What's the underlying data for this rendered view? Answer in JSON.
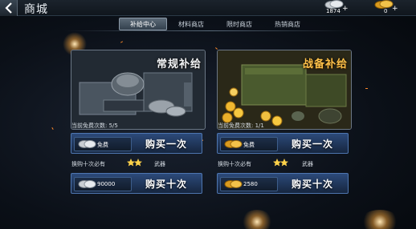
{
  "header": {
    "title": "商城",
    "back_icon": "chevron-left-icon"
  },
  "currencies": [
    {
      "icon": "silver-coin-icon",
      "amount": "1874",
      "plus": "+"
    },
    {
      "icon": "gold-coin-icon",
      "amount": "0",
      "plus": "+"
    }
  ],
  "tabs": [
    {
      "label": "补给中心",
      "active": true
    },
    {
      "label": "材料商店",
      "active": false
    },
    {
      "label": "限时商店",
      "active": false
    },
    {
      "label": "热销商店",
      "active": false
    }
  ],
  "packs": [
    {
      "banner": "常规补给",
      "free_count": "当前免费次数: 5/5",
      "buy_once": {
        "coin_icon": "silver-coin-icon",
        "price": "免费",
        "label": "购买一次"
      },
      "hint_prefix": "换购十次必有",
      "hint_reward": "武器",
      "buy_ten": {
        "coin_icon": "silver-coin-icon",
        "price": "90000",
        "label": "购买十次"
      }
    },
    {
      "banner": "战备补给",
      "free_count": "当前免费次数: 1/1",
      "buy_once": {
        "coin_icon": "gold-coin-icon",
        "price": "免费",
        "label": "购买一次"
      },
      "hint_prefix": "换购十次必有",
      "hint_reward": "武器",
      "buy_ten": {
        "coin_icon": "gold-coin-icon",
        "price": "2580",
        "label": "购买十次"
      }
    }
  ],
  "colors": {
    "button_blue": "#2c4a7a",
    "gold": "#ffc24a",
    "silver": "#d8dde2"
  }
}
